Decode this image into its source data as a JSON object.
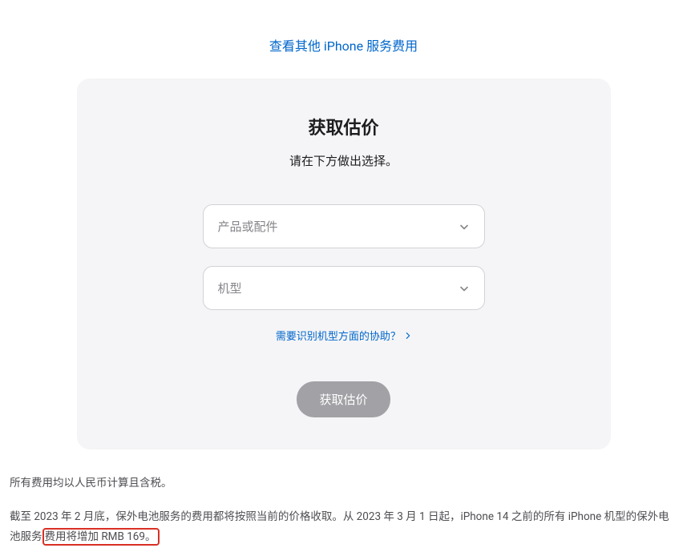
{
  "topLink": {
    "text": "查看其他 iPhone 服务费用"
  },
  "card": {
    "title": "获取估价",
    "subtitle": "请在下方做出选择。",
    "select1": {
      "placeholder": "产品或配件"
    },
    "select2": {
      "placeholder": "机型"
    },
    "helpLink": {
      "text": "需要识别机型方面的协助？"
    },
    "submitBtn": {
      "label": "获取估价"
    }
  },
  "footer": {
    "note1": "所有费用均以人民币计算且含税。",
    "note2_part1": "截至 2023 年 2 月底，保外电池服务的费用都将按照当前的价格收取。从 2023 年 3 月 1 日起，iPhone 14 之前的所有 iPhone 机型的保外电池服务",
    "note2_highlight": "费用将增加 RMB 169。"
  }
}
